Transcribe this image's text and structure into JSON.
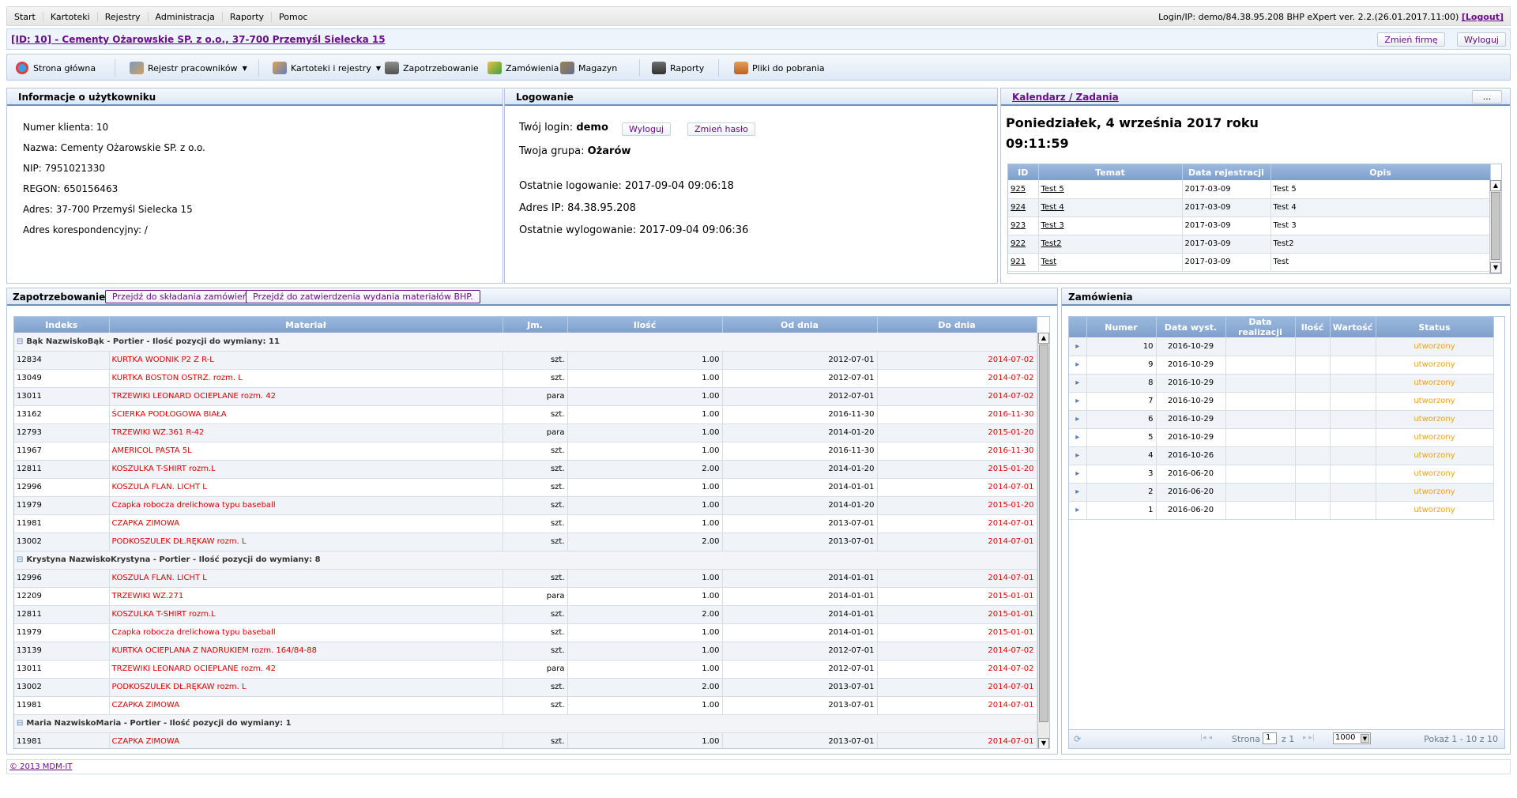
{
  "topmenu": [
    "Start",
    "Kartoteki",
    "Rejestry",
    "Administracja",
    "Raporty",
    "Pomoc"
  ],
  "login_info": "Login/IP: demo/84.38.95.208 BHP eXpert ver. 2.2.(26.01.2017.11:00)",
  "logout_link": "[Logout]",
  "company": {
    "title": "[ID: 10] - Cementy Ożarowskie SP. z o.o., 37-700 Przemyśl Sielecka 15",
    "change_btn": "Zmień firmę",
    "logout_btn": "Wyloguj"
  },
  "toolbar": {
    "home": "Strona główna",
    "employees": "Rejestr pracowników",
    "registers": "Kartoteki i rejestry",
    "demand": "Zapotrzebowanie",
    "orders": "Zamówienia",
    "warehouse": "Magazyn",
    "reports": "Raporty",
    "downloads": "Pliki do pobrania"
  },
  "user_info": {
    "title": "Informacje o użytkowniku",
    "lines": [
      "Numer klienta: 10",
      "Nazwa: Cementy Ożarowskie SP. z o.o.",
      "NIP: 7951021330",
      "REGON: 650156463",
      "Adres: 37-700 Przemyśl Sielecka 15",
      "Adres korespondencyjny: /"
    ]
  },
  "logowanie": {
    "title": "Logowanie",
    "login_label": "Twój login:",
    "login_value": "demo",
    "logout_btn": "Wyloguj",
    "change_pass_btn": "Zmień hasło",
    "group_label": "Twoja grupa:",
    "group_value": "Ożarów",
    "last_login": "Ostatnie logowanie: 2017-09-04 09:06:18",
    "ip": "Adres IP: 84.38.95.208",
    "last_logout": "Ostatnie wylogowanie: 2017-09-04 09:06:36"
  },
  "calendar": {
    "title": "Kalendarz / Zadania",
    "more_btn": "...",
    "date": "Poniedziałek, 4 września 2017 roku",
    "time": "09:11:59",
    "headers": [
      "ID",
      "Temat",
      "Data rejestracji",
      "Opis"
    ],
    "rows": [
      [
        "925",
        "Test 5",
        "2017-03-09",
        "Test 5"
      ],
      [
        "924",
        "Test 4",
        "2017-03-09",
        "Test 4"
      ],
      [
        "923",
        "Test 3",
        "2017-03-09",
        "Test 3"
      ],
      [
        "922",
        "Test2",
        "2017-03-09",
        "Test2"
      ],
      [
        "921",
        "Test",
        "2017-03-09",
        "Test"
      ]
    ]
  },
  "demand": {
    "title": "Zapotrzebowanie",
    "btn1": "Przejdź do składania zamówień.",
    "btn2": "Przejdź do zatwierdzenia wydania materiałów BHP.",
    "headers": [
      "Indeks",
      "Materiał",
      "Jm.",
      "Ilość",
      "Od dnia",
      "Do dnia"
    ],
    "groups": [
      {
        "label": "Bąk NazwiskoBąk - Portier - Ilość pozycji do wymiany: 11",
        "rows": [
          [
            "12834",
            "KURTKA WODNIK P2 Z R-L",
            "szt.",
            "1.00",
            "2012-07-01",
            "2014-07-02"
          ],
          [
            "13049",
            "KURTKA BOSTON OSTRZ. rozm. L",
            "szt.",
            "1.00",
            "2012-07-01",
            "2014-07-02"
          ],
          [
            "13011",
            "TRZEWIKI LEONARD OCIEPLANE rozm. 42",
            "para",
            "1.00",
            "2012-07-01",
            "2014-07-02"
          ],
          [
            "13162",
            "ŚCIERKA PODŁOGOWA BIAŁA",
            "szt.",
            "1.00",
            "2016-11-30",
            "2016-11-30"
          ],
          [
            "12793",
            "TRZEWIKI WZ.361 R-42",
            "para",
            "1.00",
            "2014-01-20",
            "2015-01-20"
          ],
          [
            "11967",
            "AMERICOL PASTA 5L",
            "szt.",
            "1.00",
            "2016-11-30",
            "2016-11-30"
          ],
          [
            "12811",
            "KOSZULKA T-SHIRT rozm.L",
            "szt.",
            "2.00",
            "2014-01-20",
            "2015-01-20"
          ],
          [
            "12996",
            "KOSZULA FLAN. LICHT L",
            "szt.",
            "1.00",
            "2014-01-01",
            "2014-07-01"
          ],
          [
            "11979",
            "Czapka robocza drelichowa typu baseball",
            "szt.",
            "1.00",
            "2014-01-20",
            "2015-01-20"
          ],
          [
            "11981",
            "CZAPKA ZIMOWA",
            "szt.",
            "1.00",
            "2013-07-01",
            "2014-07-01"
          ],
          [
            "13002",
            "PODKOSZULEK DŁ.RĘKAW rozm. L",
            "szt.",
            "2.00",
            "2013-07-01",
            "2014-07-01"
          ]
        ]
      },
      {
        "label": "Krystyna NazwiskoKrystyna - Portier - Ilość pozycji do wymiany: 8",
        "rows": [
          [
            "12996",
            "KOSZULA FLAN. LICHT L",
            "szt.",
            "1.00",
            "2014-01-01",
            "2014-07-01"
          ],
          [
            "12209",
            "TRZEWIKI WZ.271",
            "para",
            "1.00",
            "2014-01-01",
            "2015-01-01"
          ],
          [
            "12811",
            "KOSZULKA T-SHIRT rozm.L",
            "szt.",
            "2.00",
            "2014-01-01",
            "2015-01-01"
          ],
          [
            "11979",
            "Czapka robocza drelichowa typu baseball",
            "szt.",
            "1.00",
            "2014-01-01",
            "2015-01-01"
          ],
          [
            "13139",
            "KURTKA OCIEPLANA Z NADRUKIEM rozm. 164/84-88",
            "szt.",
            "1.00",
            "2012-07-01",
            "2014-07-02"
          ],
          [
            "13011",
            "TRZEWIKI LEONARD OCIEPLANE rozm. 42",
            "para",
            "1.00",
            "2012-07-01",
            "2014-07-02"
          ],
          [
            "13002",
            "PODKOSZULEK DŁ.RĘKAW rozm. L",
            "szt.",
            "2.00",
            "2013-07-01",
            "2014-07-01"
          ],
          [
            "11981",
            "CZAPKA ZIMOWA",
            "szt.",
            "1.00",
            "2013-07-01",
            "2014-07-01"
          ]
        ]
      },
      {
        "label": "Maria NazwiskoMaria - Portier - Ilość pozycji do wymiany: 1",
        "rows": [
          [
            "11981",
            "CZAPKA ZIMOWA",
            "szt.",
            "1.00",
            "2013-07-01",
            "2014-07-01"
          ]
        ]
      }
    ]
  },
  "orders": {
    "title": "Zamówienia",
    "headers": [
      "Numer",
      "Data wyst.",
      "Data realizacji",
      "Ilość",
      "Wartość",
      "Status"
    ],
    "rows": [
      [
        "10",
        "2016-10-29",
        "",
        "",
        "",
        "utworzony"
      ],
      [
        "9",
        "2016-10-29",
        "",
        "",
        "",
        "utworzony"
      ],
      [
        "8",
        "2016-10-29",
        "",
        "",
        "",
        "utworzony"
      ],
      [
        "7",
        "2016-10-29",
        "",
        "",
        "",
        "utworzony"
      ],
      [
        "6",
        "2016-10-29",
        "",
        "",
        "",
        "utworzony"
      ],
      [
        "5",
        "2016-10-29",
        "",
        "",
        "",
        "utworzony"
      ],
      [
        "4",
        "2016-10-26",
        "",
        "",
        "",
        "utworzony"
      ],
      [
        "3",
        "2016-06-20",
        "",
        "",
        "",
        "utworzony"
      ],
      [
        "2",
        "2016-06-20",
        "",
        "",
        "",
        "utworzony"
      ],
      [
        "1",
        "2016-06-20",
        "",
        "",
        "",
        "utworzony"
      ]
    ],
    "pager": {
      "page_label": "Strona",
      "page_value": "1",
      "of_label": "z 1",
      "page_size": "1000",
      "summary": "Pokaż 1 - 10 z 10"
    }
  },
  "footer": "© 2013 MDM-IT"
}
